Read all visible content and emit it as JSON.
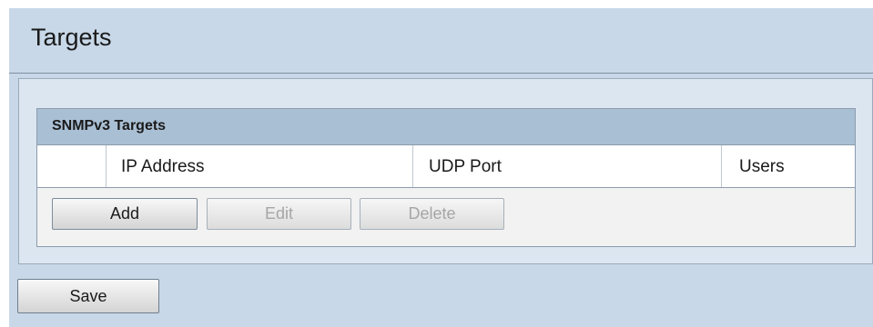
{
  "page": {
    "title": "Targets"
  },
  "targets_box": {
    "header": "SNMPv3 Targets",
    "columns": [
      "",
      "IP Address",
      "UDP Port",
      "Users"
    ]
  },
  "buttons": {
    "add": "Add",
    "edit": "Edit",
    "delete": "Delete",
    "save": "Save"
  },
  "colors": {
    "page_bg": "#c8d8e8",
    "panel_bg": "#dce6f0",
    "header_bg": "#a9bfd4"
  }
}
